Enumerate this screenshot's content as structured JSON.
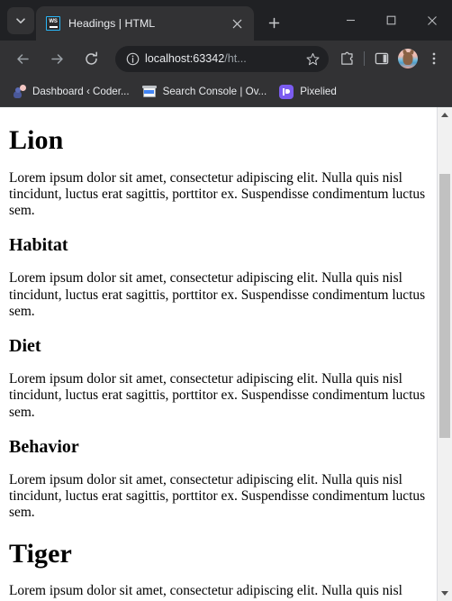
{
  "window": {
    "controls": {
      "minimize_label": "Minimize",
      "maximize_label": "Maximize",
      "close_label": "Close"
    }
  },
  "tabstrip": {
    "tab_search_label": "Search tabs",
    "new_tab_label": "New tab",
    "tabs": [
      {
        "title": "Headings | HTML",
        "favicon_name": "ws-favicon",
        "favicon_text": "WS",
        "favicon_border_color": "#29b6f6",
        "close_label": "Close tab",
        "active": true
      }
    ]
  },
  "toolbar": {
    "back_label": "Back",
    "forward_label": "Forward",
    "reload_label": "Reload",
    "omnibox": {
      "site_info_label": "View site information",
      "url_host": "localhost:63342",
      "url_path": "/ht...",
      "bookmark_label": "Bookmark this tab"
    },
    "extensions_label": "Extensions",
    "side_panel_label": "Side panel",
    "profile_label": "Profile",
    "menu_label": "Customize and control Google Chrome"
  },
  "bookmarks": [
    {
      "label": "Dashboard ‹ Coder...",
      "icon": "wordpress-avatar-icon"
    },
    {
      "label": "Search Console | Ov...",
      "icon": "search-console-icon"
    },
    {
      "label": "Pixelied",
      "icon": "pixelied-icon"
    }
  ],
  "page": {
    "blocks": [
      {
        "tag": "h1",
        "text": "Lion"
      },
      {
        "tag": "p",
        "text": "Lorem ipsum dolor sit amet, consectetur adipiscing elit. Nulla quis nisl tincidunt, luctus erat sagittis, porttitor ex. Suspendisse condimentum luctus sem."
      },
      {
        "tag": "h2",
        "text": "Habitat"
      },
      {
        "tag": "p",
        "text": "Lorem ipsum dolor sit amet, consectetur adipiscing elit. Nulla quis nisl tincidunt, luctus erat sagittis, porttitor ex. Suspendisse condimentum luctus sem."
      },
      {
        "tag": "h2",
        "text": "Diet"
      },
      {
        "tag": "p",
        "text": "Lorem ipsum dolor sit amet, consectetur adipiscing elit. Nulla quis nisl tincidunt, luctus erat sagittis, porttitor ex. Suspendisse condimentum luctus sem."
      },
      {
        "tag": "h2",
        "text": "Behavior"
      },
      {
        "tag": "p",
        "text": "Lorem ipsum dolor sit amet, consectetur adipiscing elit. Nulla quis nisl tincidunt, luctus erat sagittis, porttitor ex. Suspendisse condimentum luctus sem."
      },
      {
        "tag": "h1",
        "text": "Tiger"
      },
      {
        "tag": "p",
        "text": "Lorem ipsum dolor sit amet, consectetur adipiscing elit. Nulla quis nisl"
      }
    ]
  },
  "scrollbar": {
    "up_label": "Scroll up",
    "down_label": "Scroll down",
    "thumb_top_pct": 11,
    "thumb_height_pct": 57
  },
  "colors": {
    "chrome_bg": "#323234",
    "tabstrip_bg": "#202124",
    "text": "#e8eaed",
    "muted": "#9aa0a6",
    "page_bg": "#ffffff",
    "scroll_thumb": "#c1c1c1",
    "accent": "#7b5cf0"
  }
}
